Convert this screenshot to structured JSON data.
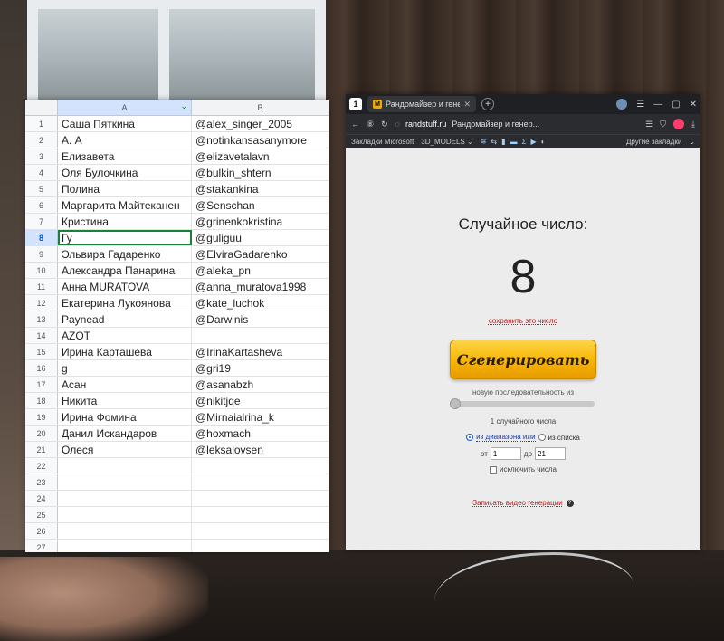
{
  "sheet": {
    "col_a": "A",
    "col_b": "B",
    "rows": [
      {
        "n": "1",
        "a": "Саша Пяткина",
        "b": "@alex_singer_2005"
      },
      {
        "n": "2",
        "a": "А. А",
        "b": "@notinkansasanymore"
      },
      {
        "n": "3",
        "a": "Елизавета",
        "b": "@elizavetalavn"
      },
      {
        "n": "4",
        "a": "Оля Булочкина",
        "b": "@bulkin_shtern"
      },
      {
        "n": "5",
        "a": "Полина",
        "b": "@stakankina"
      },
      {
        "n": "6",
        "a": "Маргарита Майтеканен",
        "b": "@Senschan"
      },
      {
        "n": "7",
        "a": "Кристина",
        "b": "@grinenkokristina"
      },
      {
        "n": "8",
        "a": "Гу",
        "b": "@guliguu"
      },
      {
        "n": "9",
        "a": "Эльвира Гадаренко",
        "b": "@ElviraGadarenko"
      },
      {
        "n": "10",
        "a": "Александра Панарина",
        "b": "@aleka_pn"
      },
      {
        "n": "11",
        "a": "Анна MURATOVA",
        "b": "@anna_muratova1998"
      },
      {
        "n": "12",
        "a": "Екатерина Лукоянова",
        "b": "@kate_luchok"
      },
      {
        "n": "13",
        "a": "Paynead",
        "b": "@Darwinis"
      },
      {
        "n": "14",
        "a": "AZOT",
        "b": ""
      },
      {
        "n": "15",
        "a": "Ирина Карташева",
        "b": "@IrinaKartasheva"
      },
      {
        "n": "16",
        "a": "g",
        "b": "@gri19"
      },
      {
        "n": "17",
        "a": "Асан",
        "b": "@asanabzh"
      },
      {
        "n": "18",
        "a": "Никита",
        "b": "@nikitjqe"
      },
      {
        "n": "19",
        "a": "Ирина Фомина",
        "b": "@Mirnaialrina_k"
      },
      {
        "n": "20",
        "a": "Данил Искандаров",
        "b": "@hoxmach"
      },
      {
        "n": "21",
        "a": "Олеся",
        "b": "@leksalovsen"
      },
      {
        "n": "22",
        "a": "",
        "b": ""
      },
      {
        "n": "23",
        "a": "",
        "b": ""
      },
      {
        "n": "24",
        "a": "",
        "b": ""
      },
      {
        "n": "25",
        "a": "",
        "b": ""
      },
      {
        "n": "26",
        "a": "",
        "b": ""
      },
      {
        "n": "27",
        "a": "",
        "b": ""
      }
    ],
    "selected_row": "8"
  },
  "browser": {
    "tab_title": "Рандомайзер и генера",
    "site": "randstuff.ru",
    "page_title": "Рандомайзер и генер...",
    "bookmarks_label": "Закладки Microsoft",
    "bookmark_folder": "3D_MODELS",
    "other_bookmarks": "Другие закладки"
  },
  "randomizer": {
    "title": "Случайное число:",
    "number": "8",
    "save_link": "сохранить это число",
    "generate_button": "Сгенерировать",
    "sequence_label": "новую последовательность из",
    "count_label": "1 случайного числа",
    "mode_range": "из диапазона или",
    "mode_list": "из списка",
    "from_label": "от",
    "from_value": "1",
    "to_label": "до",
    "to_value": "21",
    "exclude_label": "исключить числа",
    "record_link": "Записать видео генерации"
  }
}
